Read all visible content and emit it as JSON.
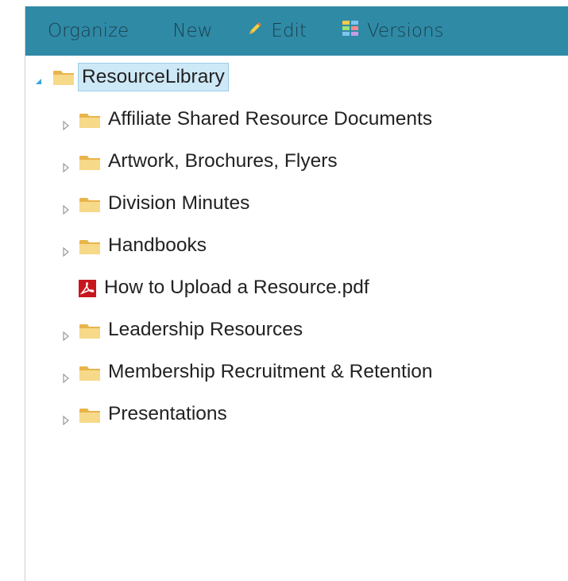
{
  "toolbar": {
    "organize": "Organize",
    "new": "New",
    "edit": "Edit",
    "versions": "Versions"
  },
  "tree": {
    "root": {
      "label": "ResourceLibrary",
      "expanded": true,
      "selected": true
    },
    "items": [
      {
        "label": "Affiliate Shared Resource Documents",
        "type": "folder"
      },
      {
        "label": "Artwork, Brochures, Flyers",
        "type": "folder"
      },
      {
        "label": "Division Minutes",
        "type": "folder"
      },
      {
        "label": "Handbooks",
        "type": "folder"
      },
      {
        "label": "How to Upload a Resource.pdf",
        "type": "pdf"
      },
      {
        "label": "Leadership Resources",
        "type": "folder"
      },
      {
        "label": "Membership Recruitment & Retention",
        "type": "folder"
      },
      {
        "label": "Presentations",
        "type": "folder"
      }
    ]
  },
  "colors": {
    "toolbar_bg": "#2f8aa6",
    "toolbar_text": "#1c3f4c",
    "selection_bg": "#cde8f7",
    "folder": "#f5c76a",
    "pdf": "#c8161d"
  }
}
